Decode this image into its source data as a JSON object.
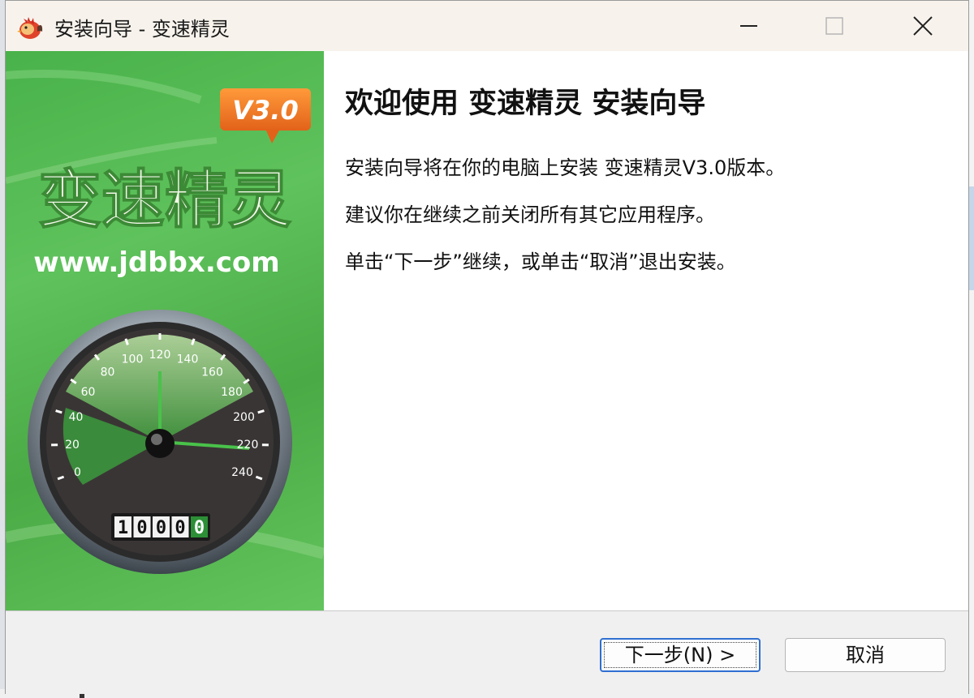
{
  "window": {
    "title": "安装向导 - 变速精灵"
  },
  "banner": {
    "brand": "变速精灵",
    "version_badge": "V3.0",
    "url": "www.jdbbx.com",
    "speedometer_ticks": [
      "0",
      "20",
      "40",
      "60",
      "80",
      "100",
      "120",
      "140",
      "160",
      "180",
      "200",
      "220",
      "240"
    ],
    "odometer": [
      "1",
      "0",
      "0",
      "0",
      "0"
    ]
  },
  "content": {
    "heading": "欢迎使用 变速精灵 安装向导",
    "line1": "安装向导将在你的电脑上安装 变速精灵V3.0版本。",
    "line2": "建议你在继续之前关闭所有其它应用程序。",
    "line3": "单击“下一步”继续，或单击“取消”退出安装。"
  },
  "buttons": {
    "next": "下一步(N) >",
    "cancel": "取消"
  },
  "colors": {
    "banner_green": "#4aaa45",
    "badge_orange": "#f07a1e",
    "focus_blue": "#2f6fd0"
  }
}
